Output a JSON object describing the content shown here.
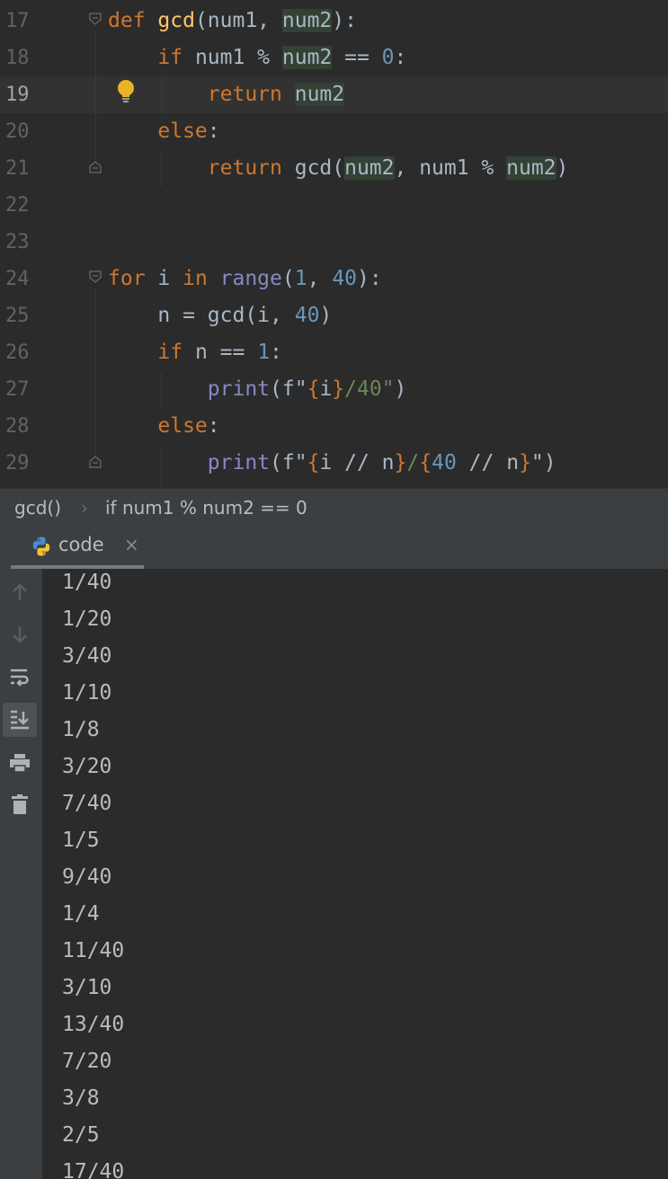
{
  "editor": {
    "current_line": 19,
    "lines": [
      {
        "n": "17",
        "tokens": [
          {
            "t": "def ",
            "c": "kw"
          },
          {
            "t": "gcd",
            "c": "fn"
          },
          {
            "t": "(num1, "
          },
          {
            "t": "num2",
            "c": "hl"
          },
          {
            "t": "):"
          }
        ]
      },
      {
        "n": "18",
        "tokens": [
          {
            "t": "    "
          },
          {
            "t": "if ",
            "c": "kw"
          },
          {
            "t": "num1 % "
          },
          {
            "t": "num2",
            "c": "hl"
          },
          {
            "t": " == "
          },
          {
            "t": "0",
            "c": "num"
          },
          {
            "t": ":"
          }
        ]
      },
      {
        "n": "19",
        "tokens": [
          {
            "t": "        "
          },
          {
            "t": "return ",
            "c": "kw"
          },
          {
            "t": "num2",
            "c": "hl"
          }
        ]
      },
      {
        "n": "20",
        "tokens": [
          {
            "t": "    "
          },
          {
            "t": "else",
            "c": "kw"
          },
          {
            "t": ":"
          }
        ]
      },
      {
        "n": "21",
        "tokens": [
          {
            "t": "        "
          },
          {
            "t": "return ",
            "c": "kw"
          },
          {
            "t": "gcd("
          },
          {
            "t": "num2",
            "c": "hl"
          },
          {
            "t": ", num1 % "
          },
          {
            "t": "num2",
            "c": "hl"
          },
          {
            "t": ")"
          }
        ]
      },
      {
        "n": "22",
        "tokens": []
      },
      {
        "n": "23",
        "tokens": []
      },
      {
        "n": "24",
        "tokens": [
          {
            "t": "for ",
            "c": "kw"
          },
          {
            "t": "i "
          },
          {
            "t": "in ",
            "c": "kw"
          },
          {
            "t": "range",
            "c": "bi"
          },
          {
            "t": "("
          },
          {
            "t": "1",
            "c": "num"
          },
          {
            "t": ", "
          },
          {
            "t": "40",
            "c": "num"
          },
          {
            "t": "):"
          }
        ]
      },
      {
        "n": "25",
        "tokens": [
          {
            "t": "    n = gcd(i, "
          },
          {
            "t": "40",
            "c": "num"
          },
          {
            "t": ")"
          }
        ]
      },
      {
        "n": "26",
        "tokens": [
          {
            "t": "    "
          },
          {
            "t": "if ",
            "c": "kw"
          },
          {
            "t": "n == "
          },
          {
            "t": "1",
            "c": "num"
          },
          {
            "t": ":"
          }
        ]
      },
      {
        "n": "27",
        "tokens": [
          {
            "t": "        "
          },
          {
            "t": "print",
            "c": "bi"
          },
          {
            "t": "(f\"",
            "c": ""
          },
          {
            "t": "{",
            "c": "kw"
          },
          {
            "t": "i"
          },
          {
            "t": "}",
            "c": "kw"
          },
          {
            "t": "/40\"",
            "c": "str"
          },
          {
            "t": ")"
          }
        ]
      },
      {
        "n": "28",
        "tokens": [
          {
            "t": "    "
          },
          {
            "t": "else",
            "c": "kw"
          },
          {
            "t": ":"
          }
        ]
      },
      {
        "n": "29",
        "tokens": [
          {
            "t": "        "
          },
          {
            "t": "print",
            "c": "bi"
          },
          {
            "t": "(f\""
          },
          {
            "t": "{",
            "c": "kw"
          },
          {
            "t": "i // n"
          },
          {
            "t": "}",
            "c": "kw"
          },
          {
            "t": "/",
            "c": "str"
          },
          {
            "t": "{",
            "c": "kw"
          },
          {
            "t": "40",
            "c": "num"
          },
          {
            "t": " // n"
          },
          {
            "t": "}",
            "c": "kw"
          },
          {
            "t": "\")"
          }
        ]
      }
    ]
  },
  "breadcrumb": {
    "function": "gcd()",
    "separator": "›",
    "condition": "if num1 % num2 == 0"
  },
  "run_tab": {
    "label": "code",
    "close": "×",
    "icon": "python-icon"
  },
  "toolbar": {
    "buttons": [
      "up-arrow-icon",
      "down-arrow-icon",
      "soft-wrap-icon",
      "scroll-to-end-icon",
      "print-icon",
      "trash-icon"
    ],
    "active": "scroll-to-end-icon"
  },
  "output": [
    "1/40",
    "1/20",
    "3/40",
    "1/10",
    "1/8",
    "3/20",
    "7/40",
    "1/5",
    "9/40",
    "1/4",
    "11/40",
    "3/10",
    "13/40",
    "7/20",
    "3/8",
    "2/5",
    "17/40"
  ],
  "colors": {
    "keyword": "#cc7832",
    "function": "#ffc66d",
    "number": "#6897bb",
    "builtin": "#8888c6",
    "string": "#6a8759",
    "text": "#a9b7c6",
    "highlight": "#344134",
    "bulb": "#e8b325"
  }
}
